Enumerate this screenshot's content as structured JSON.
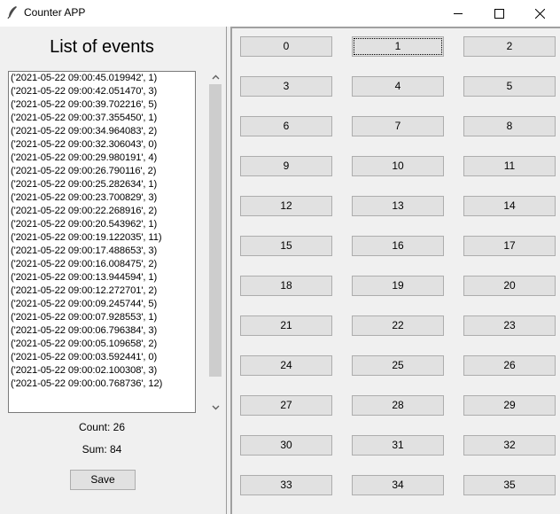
{
  "window": {
    "title": "Counter APP",
    "icon": "feather-icon"
  },
  "events_panel": {
    "title": "List of events",
    "events": [
      "('2021-05-22 09:00:45.019942', 1)",
      "('2021-05-22 09:00:42.051470', 3)",
      "('2021-05-22 09:00:39.702216', 5)",
      "('2021-05-22 09:00:37.355450', 1)",
      "('2021-05-22 09:00:34.964083', 2)",
      "('2021-05-22 09:00:32.306043', 0)",
      "('2021-05-22 09:00:29.980191', 4)",
      "('2021-05-22 09:00:26.790116', 2)",
      "('2021-05-22 09:00:25.282634', 1)",
      "('2021-05-22 09:00:23.700829', 3)",
      "('2021-05-22 09:00:22.268916', 2)",
      "('2021-05-22 09:00:20.543962', 1)",
      "('2021-05-22 09:00:19.122035', 11)",
      "('2021-05-22 09:00:17.488653', 3)",
      "('2021-05-22 09:00:16.008475', 2)",
      "('2021-05-22 09:00:13.944594', 1)",
      "('2021-05-22 09:00:12.272701', 2)",
      "('2021-05-22 09:00:09.245744', 5)",
      "('2021-05-22 09:00:07.928553', 1)",
      "('2021-05-22 09:00:06.796384', 3)",
      "('2021-05-22 09:00:05.109658', 2)",
      "('2021-05-22 09:00:03.592441', 0)",
      "('2021-05-22 09:00:02.100308', 3)",
      "('2021-05-22 09:00:00.768736', 12)"
    ],
    "count_label": "Count: 26",
    "sum_label": "Sum: 84",
    "save_label": "Save"
  },
  "counter_buttons": {
    "focused": "1",
    "labels": [
      "0",
      "1",
      "2",
      "3",
      "4",
      "5",
      "6",
      "7",
      "8",
      "9",
      "10",
      "11",
      "12",
      "13",
      "14",
      "15",
      "16",
      "17",
      "18",
      "19",
      "20",
      "21",
      "22",
      "23",
      "24",
      "25",
      "26",
      "27",
      "28",
      "29",
      "30",
      "31",
      "32",
      "33",
      "34",
      "35"
    ]
  }
}
